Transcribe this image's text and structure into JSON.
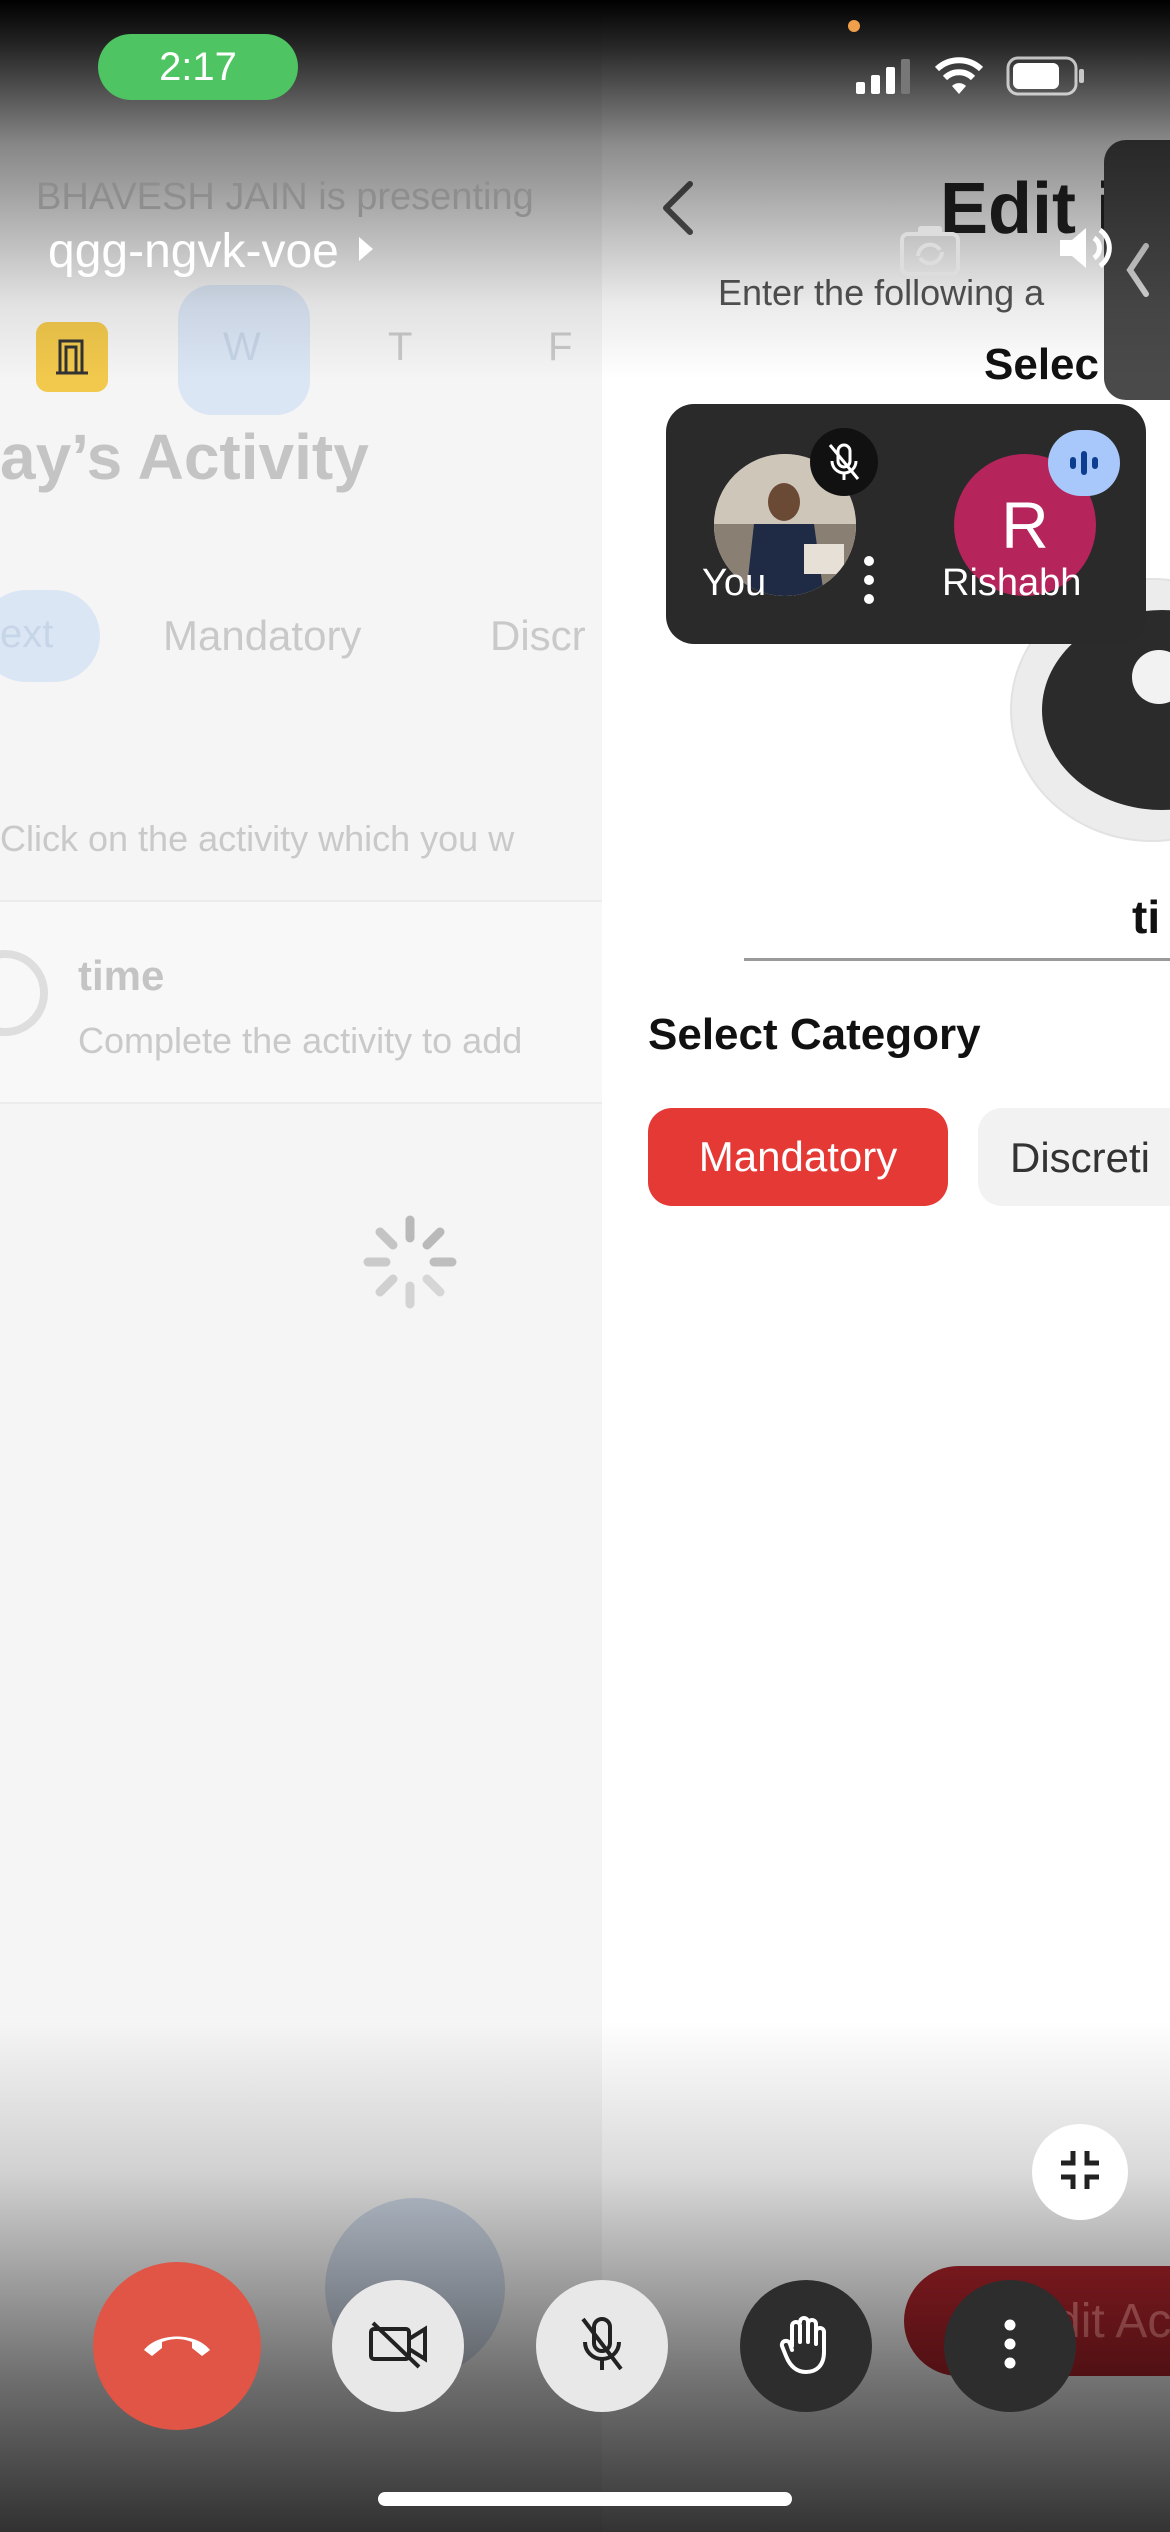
{
  "status_bar": {
    "time": "2:17"
  },
  "meeting": {
    "presenter_text": "BHAVESH JAIN is presenting",
    "code": "qgg-ngvk-voe"
  },
  "left_app": {
    "week_days": [
      "W",
      "T",
      "F"
    ],
    "title": "ay’s Activity",
    "tabs": [
      "ext",
      "Mandatory",
      "Discr"
    ],
    "hint": "Click on the activity which you w",
    "activity": {
      "name": "time",
      "desc": "Complete the activity to add"
    }
  },
  "right_app": {
    "title": "Edit i",
    "subtitle": "Enter the following a",
    "select_header": "Selec",
    "name_value": "ti",
    "select_category_label": "Select Category",
    "category_chips": [
      "Mandatory",
      "Discreti"
    ],
    "edit_button": "dit Ac"
  },
  "participants": [
    {
      "name": "You"
    },
    {
      "name": "Rishabh",
      "initial": "R"
    }
  ],
  "colors": {
    "mandatory_chip": "#e53935",
    "end_call": "#e05545",
    "avatar_r": "#b5245b",
    "green_pill": "#4fc462"
  }
}
